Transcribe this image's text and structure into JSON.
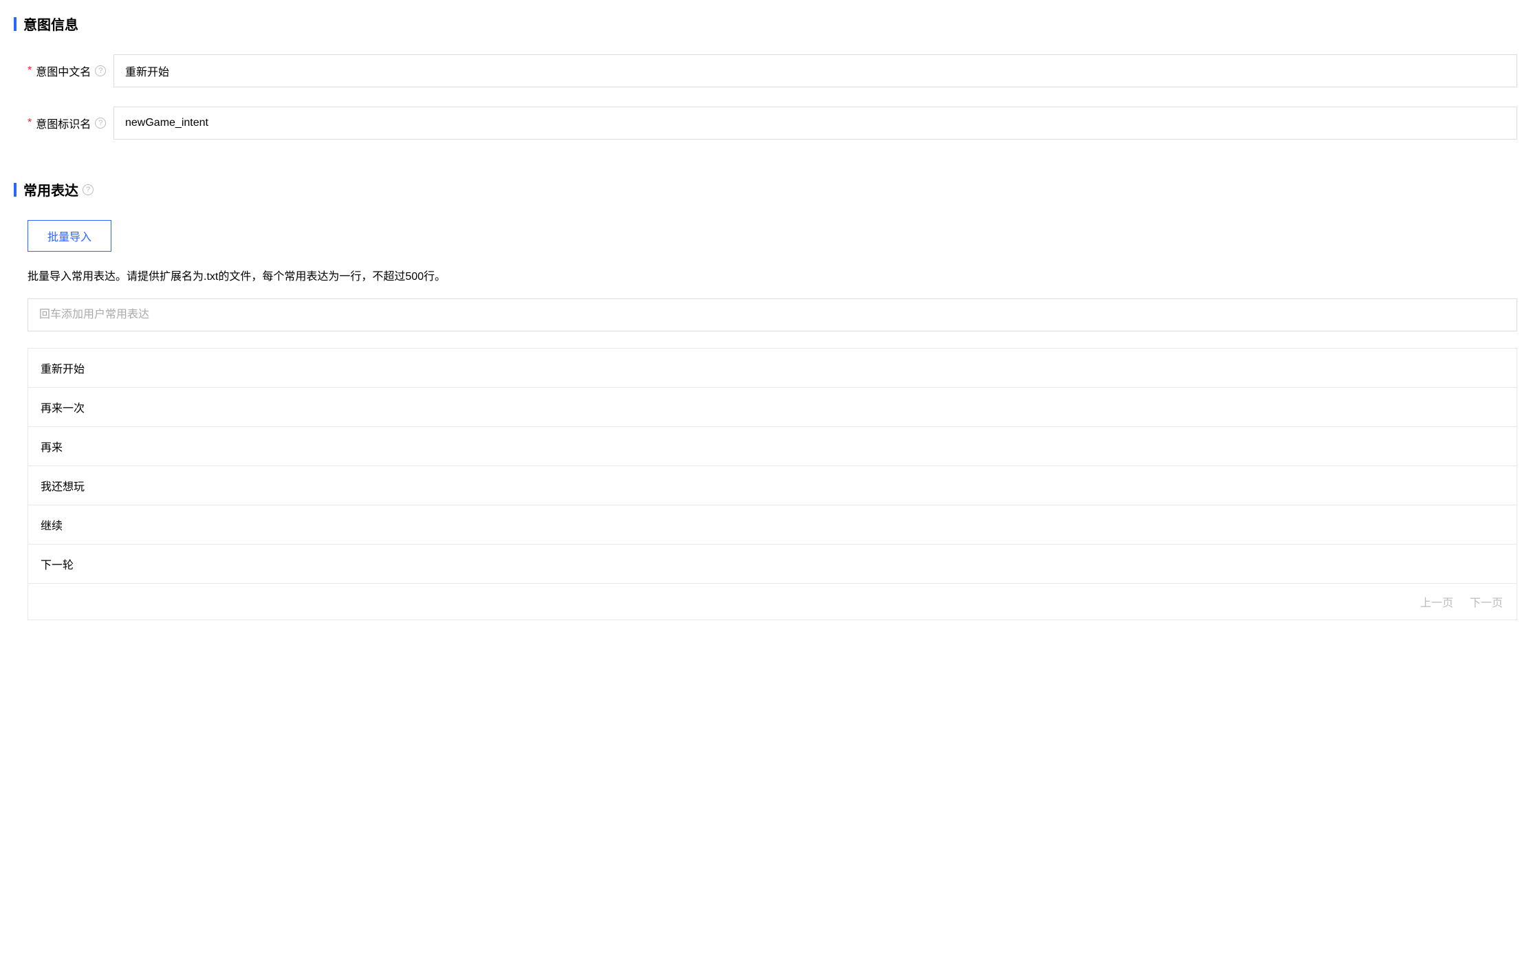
{
  "sections": {
    "intent_info": {
      "title": "意图信息"
    },
    "expressions": {
      "title": "常用表达"
    }
  },
  "form": {
    "chinese_name": {
      "label": "意图中文名",
      "value": "重新开始"
    },
    "identifier": {
      "label": "意图标识名",
      "value": "newGame_intent"
    }
  },
  "expressions": {
    "import_button": "批量导入",
    "description": "批量导入常用表达。请提供扩展名为.txt的文件，每个常用表达为一行，不超过500行。",
    "input_placeholder": "回车添加用户常用表达",
    "items": [
      "重新开始",
      "再来一次",
      "再来",
      "我还想玩",
      "继续",
      "下一轮"
    ]
  },
  "pagination": {
    "prev": "上一页",
    "next": "下一页"
  }
}
